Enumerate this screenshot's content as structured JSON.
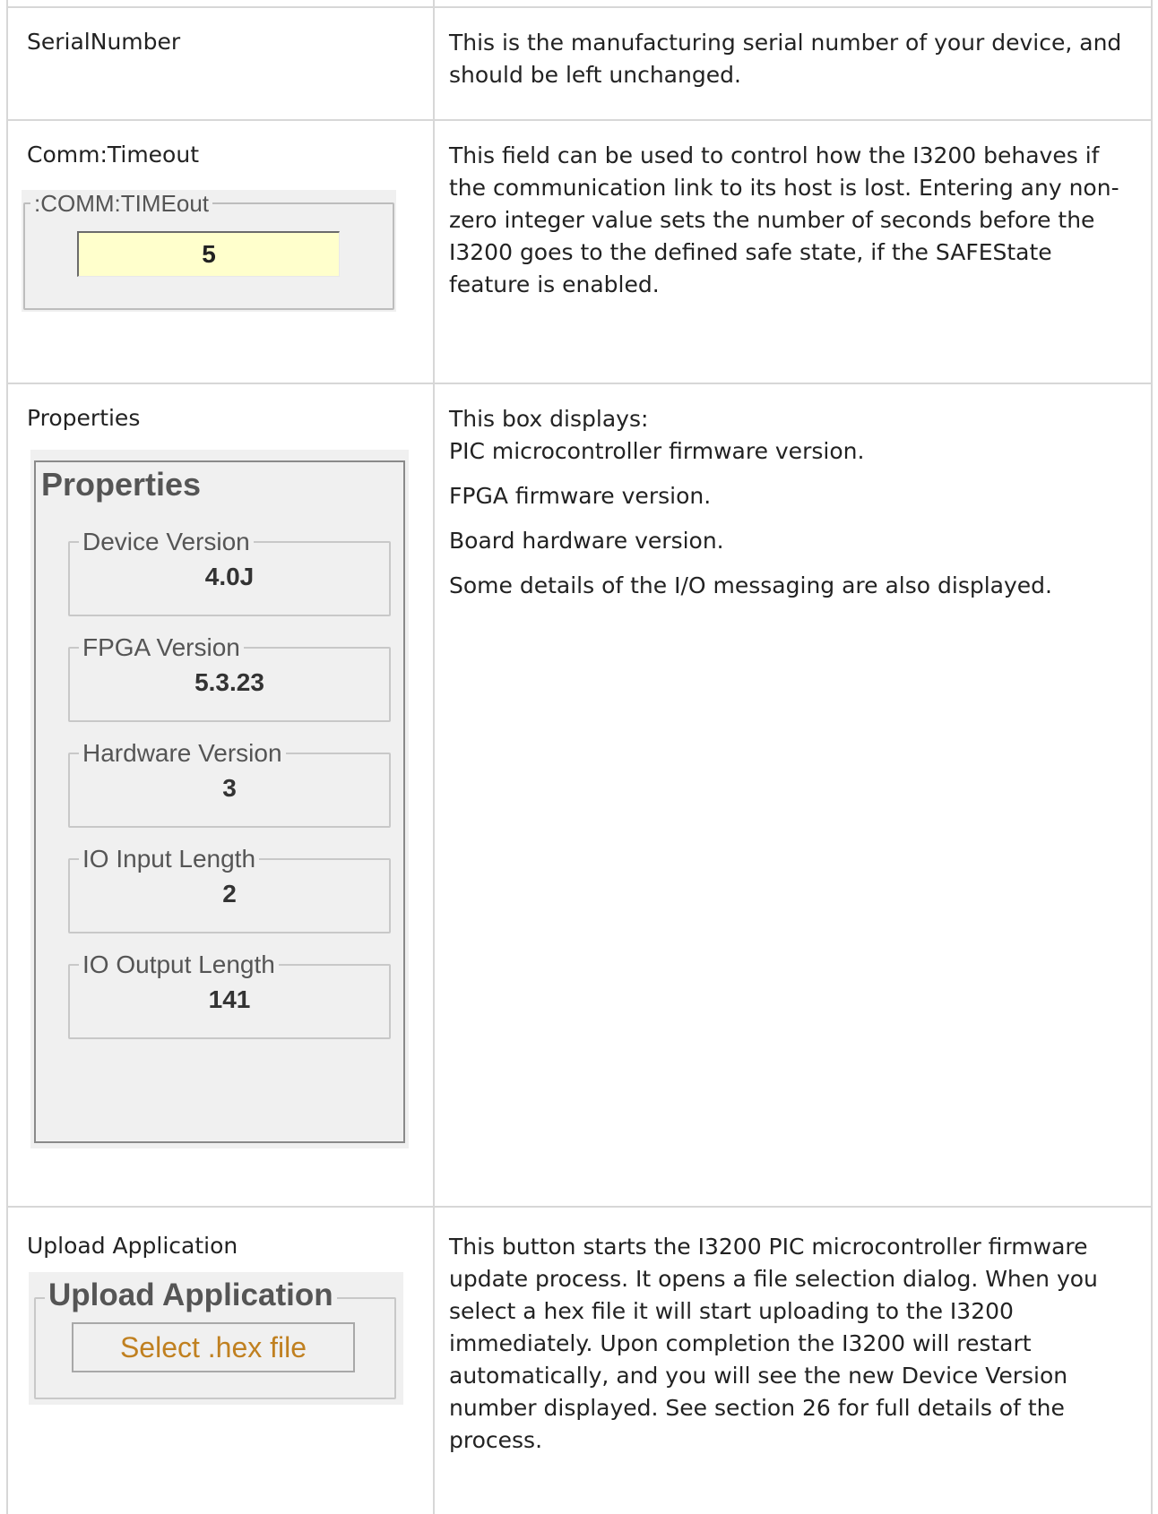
{
  "rows": [
    {
      "label": "SerialNumber",
      "description": [
        "This is the manufacturing serial number of your device, and should be left unchanged."
      ]
    },
    {
      "label": "Comm:Timeout",
      "widget": {
        "legend": ":COMM:TIMEout",
        "value": "5",
        "field_color": "#ffffcc"
      },
      "description": [
        "This field can be used to control how the I3200 behaves if the communication link to its host is lost.  Entering any non-zero integer value sets the number of seconds before the I3200 goes to the defined safe state, if the SAFEState feature is enabled."
      ]
    },
    {
      "label": "Properties",
      "widget": {
        "title": "Properties",
        "groups": [
          {
            "legend": "Device Version",
            "value": "4.0J"
          },
          {
            "legend": "FPGA Version",
            "value": "5.3.23"
          },
          {
            "legend": "Hardware Version",
            "value": "3"
          },
          {
            "legend": "IO Input Length",
            "value": "2"
          },
          {
            "legend": "IO Output Length",
            "value": "141"
          }
        ]
      },
      "description": [
        "This box displays:",
        "PIC microcontroller firmware version.",
        "FPGA firmware version.",
        "Board hardware version.",
        "Some details of the I/O messaging are also displayed."
      ]
    },
    {
      "label": "Upload Application",
      "widget": {
        "legend": "Upload Application",
        "button_label": "Select .hex file",
        "button_text_color": "#c08020"
      },
      "description": [
        "This button starts the I3200 PIC microcontroller firmware update process.  It opens a file selection dialog.  When you select a hex file it will start uploading to the I3200 immediately.  Upon completion the I3200 will restart automatically, and you will see the new Device Version number displayed.  See section 26 for full details of the process."
      ]
    }
  ]
}
